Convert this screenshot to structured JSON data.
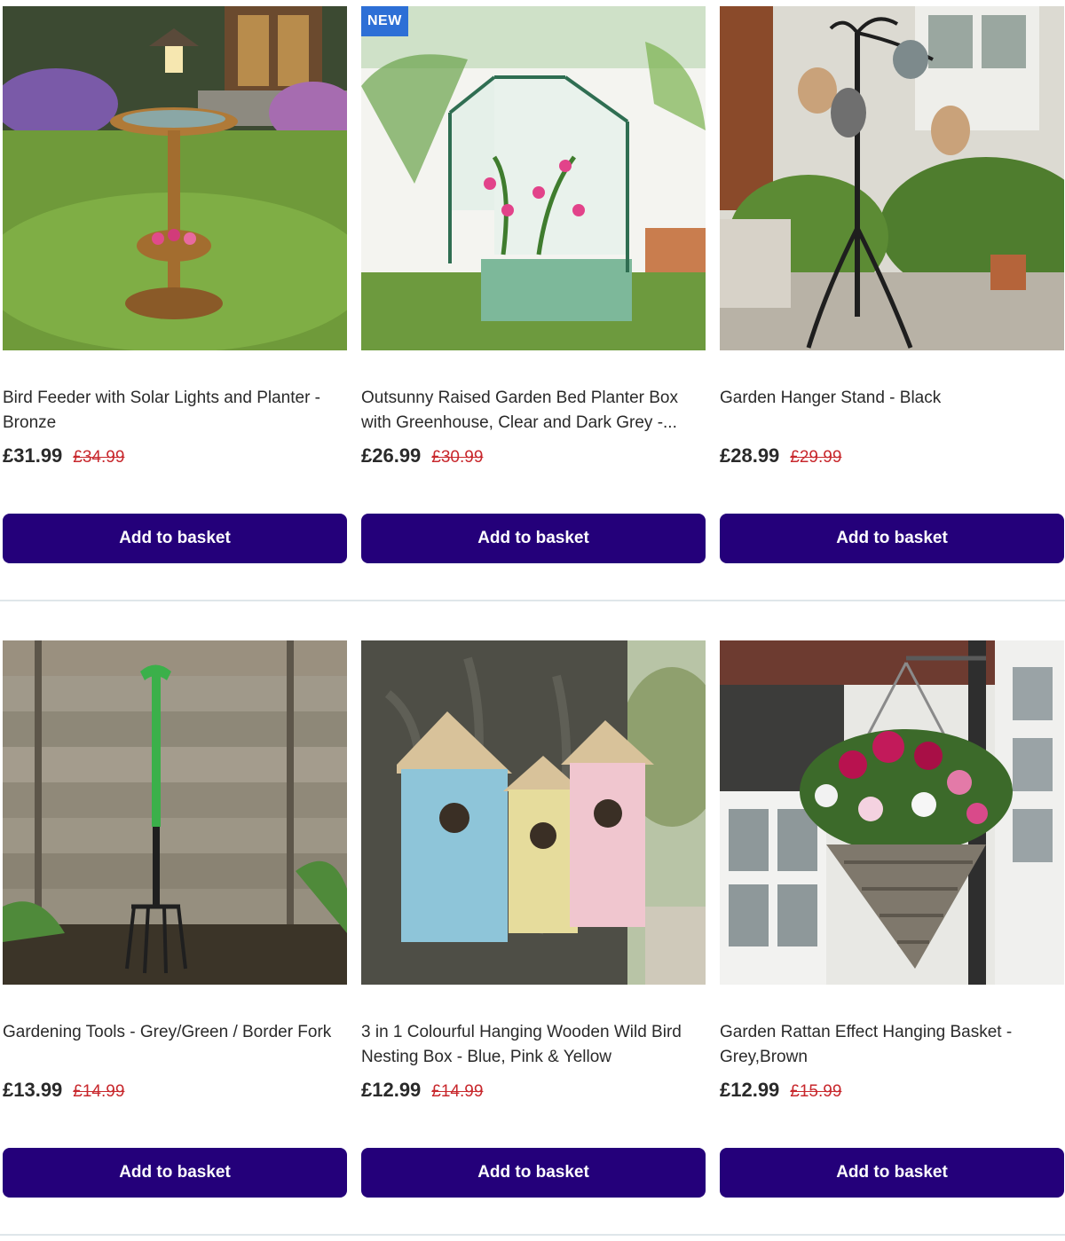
{
  "products": [
    {
      "title": "Bird Feeder with Solar Lights and Planter - Bronze",
      "price": "£31.99",
      "was_price": "£34.99",
      "button_label": "Add to basket",
      "badge": ""
    },
    {
      "title": "Outsunny Raised Garden Bed Planter Box with Greenhouse, Clear and Dark Grey -...",
      "price": "£26.99",
      "was_price": "£30.99",
      "button_label": "Add to basket",
      "badge": "NEW"
    },
    {
      "title": "Garden Hanger Stand - Black",
      "price": "£28.99",
      "was_price": "£29.99",
      "button_label": "Add to basket",
      "badge": ""
    },
    {
      "title": "Gardening Tools - Grey/Green / Border Fork",
      "price": "£13.99",
      "was_price": "£14.99",
      "button_label": "Add to basket",
      "badge": ""
    },
    {
      "title": "3 in 1 Colourful Hanging Wooden Wild Bird Nesting Box - Blue, Pink & Yellow",
      "price": "£12.99",
      "was_price": "£14.99",
      "button_label": "Add to basket",
      "badge": ""
    },
    {
      "title": "Garden Rattan Effect Hanging Basket - Grey,Brown",
      "price": "£12.99",
      "was_price": "£15.99",
      "button_label": "Add to basket",
      "badge": ""
    }
  ],
  "colors": {
    "button": "#24007a",
    "was_price": "#c8282d",
    "badge": "#2d6fd6",
    "divider": "#dfe6ea"
  }
}
